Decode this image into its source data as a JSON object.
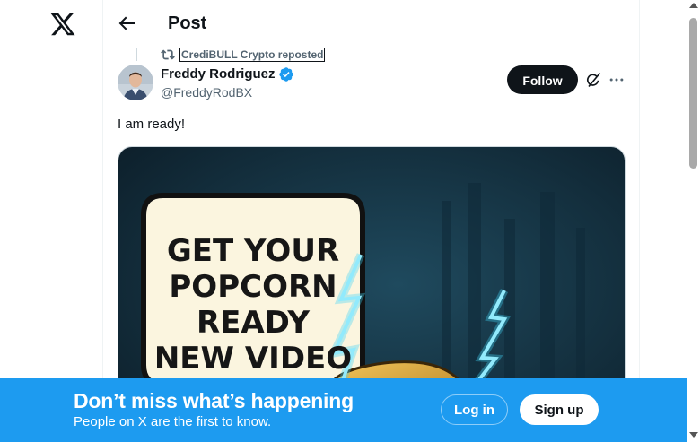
{
  "header": {
    "title": "Post"
  },
  "repost": {
    "text": "CrediBULL Crypto reposted"
  },
  "post": {
    "author_name": "Freddy Rodriguez",
    "author_handle": "@FreddyRodBX",
    "follow_label": "Follow",
    "text": "I am ready!",
    "media_text_lines": [
      "GET YOUR",
      "POPCORN",
      "READY",
      "NEW VIDEO"
    ]
  },
  "banner": {
    "heading": "Don’t miss what’s happening",
    "subtext": "People on X are the first to know.",
    "login_label": "Log in",
    "signup_label": "Sign up"
  },
  "colors": {
    "brand_blue": "#1d9bf0",
    "text_primary": "#0f1419",
    "text_secondary": "#536471",
    "verified_blue": "#1d9bf0"
  },
  "icons": {
    "logo": "x-logo-icon",
    "back": "back-arrow-icon",
    "repost": "repost-icon",
    "verified": "verified-badge-icon",
    "grok": "grok-icon",
    "more": "more-options-icon"
  }
}
